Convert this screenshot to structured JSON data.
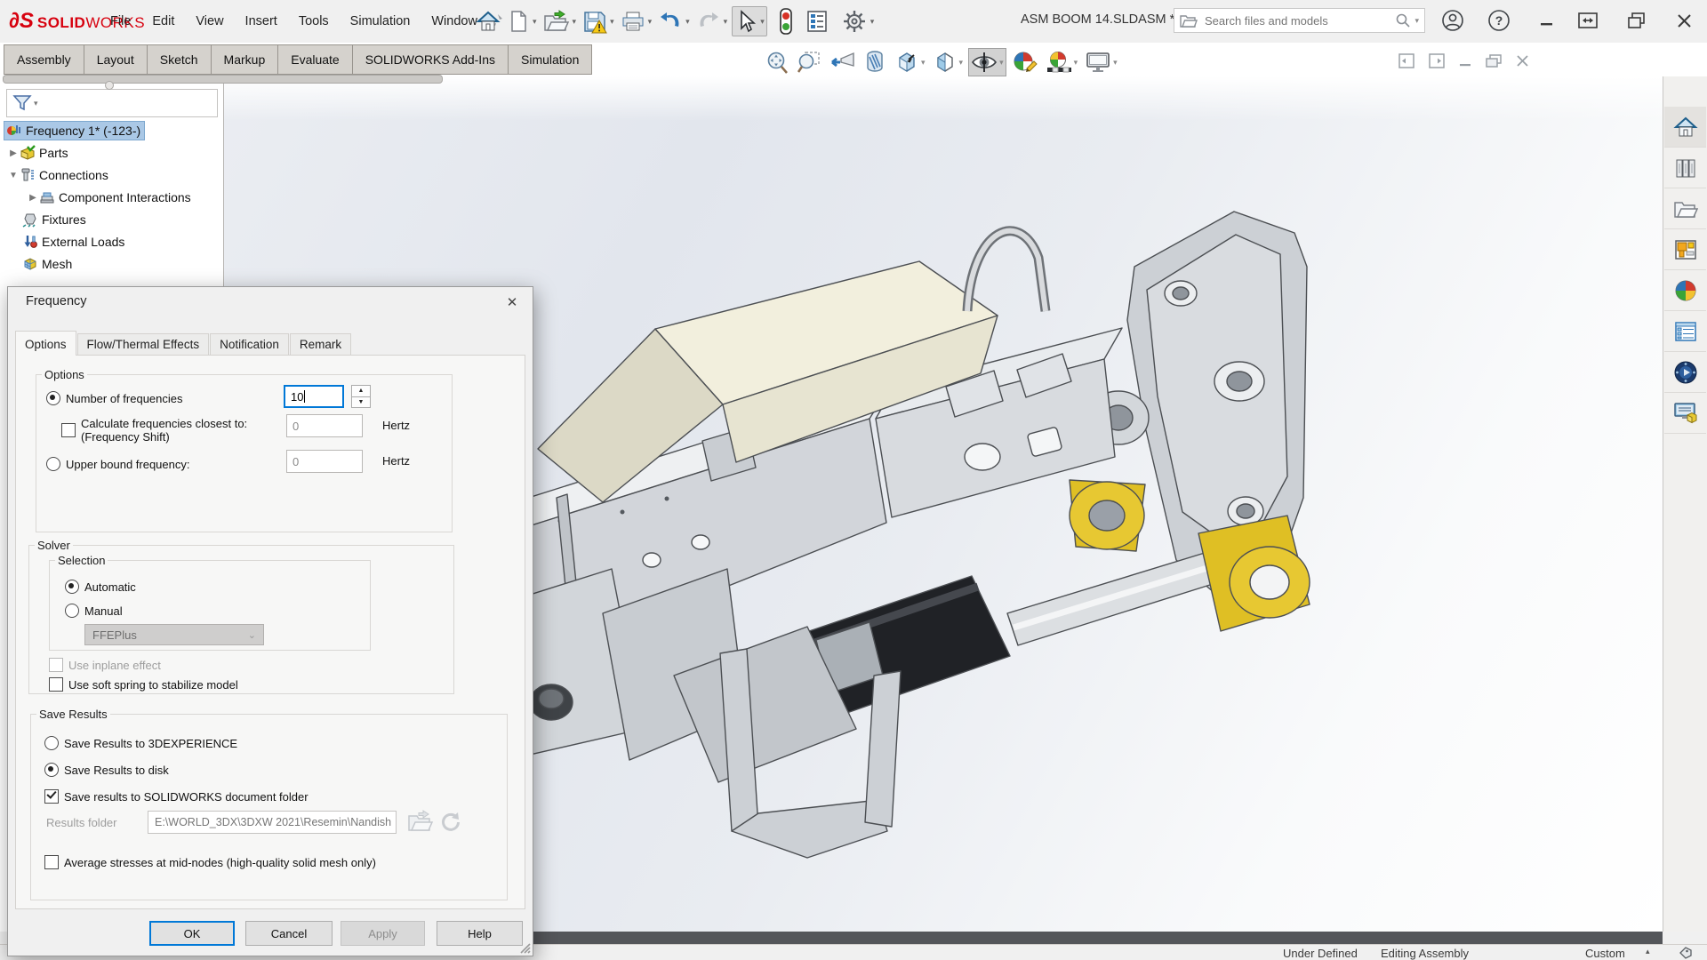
{
  "window": {
    "logo_mark": "∂S",
    "logo_bold": "SOLID",
    "logo_light": "WORKS",
    "menus": [
      "File",
      "Edit",
      "View",
      "Insert",
      "Tools",
      "Simulation",
      "Window"
    ],
    "doc_title": "ASM BOOM 14.SLDASM * ...",
    "search_placeholder": "Search files and models",
    "toolbar_icons": [
      "home-icon",
      "new-document-icon",
      "open-icon",
      "save-icon",
      "print-icon",
      "undo-icon",
      "redo-icon",
      "select-cursor-icon",
      "traffic-light-icon",
      "design-checker-icon",
      "options-gear-icon"
    ]
  },
  "ribbon_tabs": [
    "Assembly",
    "Layout",
    "Sketch",
    "Markup",
    "Evaluate",
    "SOLIDWORKS Add-Ins",
    "Simulation"
  ],
  "headsup_icons": [
    "zoom-to-fit-icon",
    "zoom-to-area-icon",
    "previous-view-icon",
    "section-view-icon",
    "view-orientation-icon",
    "display-style-icon",
    "hide-show-items-eye-icon",
    "edit-appearance-icon",
    "apply-scene-icon",
    "view-settings-icon"
  ],
  "tree": {
    "items": [
      {
        "label": "Frequency 1* (-123-)",
        "selected": true
      },
      {
        "label": "Parts"
      },
      {
        "label": "Connections"
      },
      {
        "label": "Component Interactions"
      },
      {
        "label": "Fixtures"
      },
      {
        "label": "External Loads"
      },
      {
        "label": "Mesh"
      }
    ]
  },
  "taskpane_icons": [
    "home-icon",
    "design-library-icon",
    "file-explorer-icon",
    "view-palette-icon",
    "appearances-scenes-icon",
    "custom-properties-icon",
    "3dexperience-icon",
    "solidworks-resources-icon"
  ],
  "dialog": {
    "title": "Frequency",
    "tabs": [
      "Options",
      "Flow/Thermal Effects",
      "Notification",
      "Remark"
    ],
    "options_group": {
      "legend": "Options",
      "num_freq_label": "Number of frequencies",
      "num_freq_value": "10",
      "calc_label_line1": "Calculate frequencies closest to:",
      "calc_label_line2": "(Frequency Shift)",
      "calc_value": "0",
      "hertz": "Hertz",
      "upper_label": "Upper bound frequency:",
      "upper_value": "0"
    },
    "solver_group": {
      "legend": "Solver",
      "selection_legend": "Selection",
      "automatic_label": "Automatic",
      "manual_label": "Manual",
      "solver_name": "FFEPlus",
      "inplane_label": "Use inplane effect",
      "soft_spring_label": "Use soft spring to stabilize model"
    },
    "save_group": {
      "legend": "Save Results",
      "opt_3dx": "Save Results to 3DEXPERIENCE",
      "opt_disk": "Save Results to disk",
      "chk_sw_folder": "Save results to SOLIDWORKS document folder",
      "folder_label": "Results folder",
      "folder_value": "E:\\WORLD_3DX\\3DXW 2021\\Resemin\\Nandish",
      "chk_avg": "Average stresses at mid-nodes (high-quality solid mesh only)"
    },
    "buttons": {
      "ok": "OK",
      "cancel": "Cancel",
      "apply": "Apply",
      "help": "Help"
    }
  },
  "status_bar": {
    "left": "Under Defined",
    "middle": "Editing Assembly",
    "right": "Custom"
  },
  "colors": {
    "accent_blue": "#0078d7",
    "logo_red": "#d7000e",
    "selection_blue": "#aac8e6",
    "part_yellow": "#e7c832",
    "warning_yellow": "#f6c915"
  }
}
